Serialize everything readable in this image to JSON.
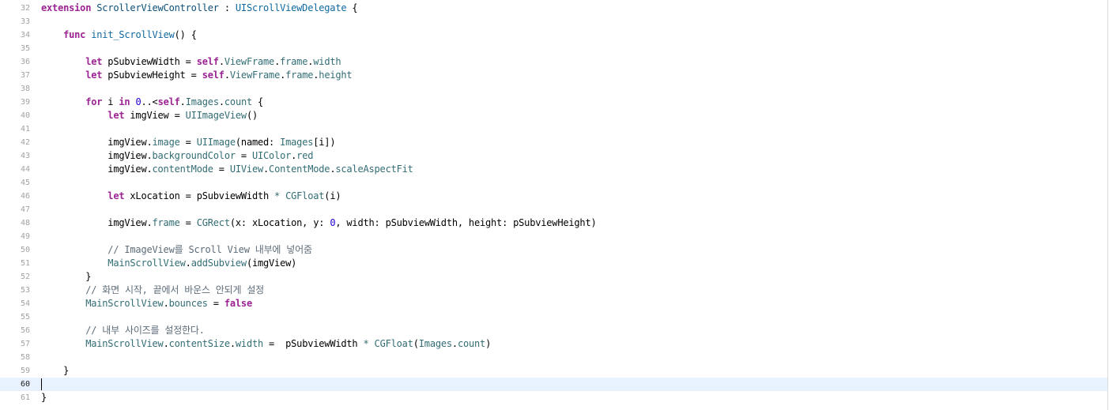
{
  "editor": {
    "current_line": 60,
    "lines": [
      {
        "n": "32",
        "tokens": [
          [
            "kw",
            "extension"
          ],
          [
            "plain",
            " "
          ],
          [
            "type",
            "ScrollerViewController"
          ],
          [
            "plain",
            " : "
          ],
          [
            "typedecl",
            "UIScrollViewDelegate"
          ],
          [
            "plain",
            " {"
          ]
        ]
      },
      {
        "n": "33",
        "tokens": []
      },
      {
        "n": "34",
        "tokens": [
          [
            "plain",
            "    "
          ],
          [
            "kw",
            "func"
          ],
          [
            "plain",
            " "
          ],
          [
            "typedecl",
            "init_ScrollView"
          ],
          [
            "plain",
            "() {"
          ]
        ]
      },
      {
        "n": "35",
        "tokens": []
      },
      {
        "n": "36",
        "tokens": [
          [
            "plain",
            "        "
          ],
          [
            "kw",
            "let"
          ],
          [
            "plain",
            " pSubviewWidth = "
          ],
          [
            "kw",
            "self"
          ],
          [
            "plain",
            "."
          ],
          [
            "prop",
            "ViewFrame"
          ],
          [
            "plain",
            "."
          ],
          [
            "prop",
            "frame"
          ],
          [
            "plain",
            "."
          ],
          [
            "prop",
            "width"
          ]
        ]
      },
      {
        "n": "37",
        "tokens": [
          [
            "plain",
            "        "
          ],
          [
            "kw",
            "let"
          ],
          [
            "plain",
            " pSubviewHeight = "
          ],
          [
            "kw",
            "self"
          ],
          [
            "plain",
            "."
          ],
          [
            "prop",
            "ViewFrame"
          ],
          [
            "plain",
            "."
          ],
          [
            "prop",
            "frame"
          ],
          [
            "plain",
            "."
          ],
          [
            "prop",
            "height"
          ]
        ]
      },
      {
        "n": "38",
        "tokens": []
      },
      {
        "n": "39",
        "tokens": [
          [
            "plain",
            "        "
          ],
          [
            "kw",
            "for"
          ],
          [
            "plain",
            " i "
          ],
          [
            "kw",
            "in"
          ],
          [
            "plain",
            " "
          ],
          [
            "num",
            "0"
          ],
          [
            "plain",
            "..<"
          ],
          [
            "kw",
            "self"
          ],
          [
            "plain",
            "."
          ],
          [
            "prop",
            "Images"
          ],
          [
            "plain",
            "."
          ],
          [
            "prop",
            "count"
          ],
          [
            "plain",
            " {"
          ]
        ]
      },
      {
        "n": "40",
        "tokens": [
          [
            "plain",
            "            "
          ],
          [
            "kw",
            "let"
          ],
          [
            "plain",
            " imgView = "
          ],
          [
            "prop",
            "UIImageView"
          ],
          [
            "plain",
            "()"
          ]
        ]
      },
      {
        "n": "41",
        "tokens": []
      },
      {
        "n": "42",
        "tokens": [
          [
            "plain",
            "            imgView."
          ],
          [
            "prop",
            "image"
          ],
          [
            "plain",
            " = "
          ],
          [
            "prop",
            "UIImage"
          ],
          [
            "plain",
            "(named: "
          ],
          [
            "prop",
            "Images"
          ],
          [
            "plain",
            "[i])"
          ]
        ]
      },
      {
        "n": "43",
        "tokens": [
          [
            "plain",
            "            imgView."
          ],
          [
            "prop",
            "backgroundColor"
          ],
          [
            "plain",
            " = "
          ],
          [
            "prop",
            "UIColor"
          ],
          [
            "plain",
            "."
          ],
          [
            "prop",
            "red"
          ]
        ]
      },
      {
        "n": "44",
        "tokens": [
          [
            "plain",
            "            imgView."
          ],
          [
            "prop",
            "contentMode"
          ],
          [
            "plain",
            " = "
          ],
          [
            "prop",
            "UIView"
          ],
          [
            "plain",
            "."
          ],
          [
            "prop",
            "ContentMode"
          ],
          [
            "plain",
            "."
          ],
          [
            "prop",
            "scaleAspectFit"
          ]
        ]
      },
      {
        "n": "45",
        "tokens": []
      },
      {
        "n": "46",
        "tokens": [
          [
            "plain",
            "            "
          ],
          [
            "kw",
            "let"
          ],
          [
            "plain",
            " xLocation = pSubviewWidth "
          ],
          [
            "prop",
            "*"
          ],
          [
            "plain",
            " "
          ],
          [
            "prop",
            "CGFloat"
          ],
          [
            "plain",
            "(i)"
          ]
        ]
      },
      {
        "n": "47",
        "tokens": []
      },
      {
        "n": "48",
        "tokens": [
          [
            "plain",
            "            imgView."
          ],
          [
            "prop",
            "frame"
          ],
          [
            "plain",
            " = "
          ],
          [
            "prop",
            "CGRect"
          ],
          [
            "plain",
            "(x: xLocation, y: "
          ],
          [
            "num",
            "0"
          ],
          [
            "plain",
            ", width: pSubviewWidth, height: pSubviewHeight)"
          ]
        ]
      },
      {
        "n": "49",
        "tokens": []
      },
      {
        "n": "50",
        "tokens": [
          [
            "plain",
            "            "
          ],
          [
            "comment",
            "// ImageView를 Scroll View 내부에 넣어줌"
          ]
        ]
      },
      {
        "n": "51",
        "tokens": [
          [
            "plain",
            "            "
          ],
          [
            "prop",
            "MainScrollView"
          ],
          [
            "plain",
            "."
          ],
          [
            "prop",
            "addSubview"
          ],
          [
            "plain",
            "(imgView)"
          ]
        ]
      },
      {
        "n": "52",
        "tokens": [
          [
            "plain",
            "        }"
          ]
        ]
      },
      {
        "n": "53",
        "tokens": [
          [
            "plain",
            "        "
          ],
          [
            "comment",
            "// 화면 시작, 끝에서 바운스 안되게 설정"
          ]
        ]
      },
      {
        "n": "54",
        "tokens": [
          [
            "plain",
            "        "
          ],
          [
            "prop",
            "MainScrollView"
          ],
          [
            "plain",
            "."
          ],
          [
            "prop",
            "bounces"
          ],
          [
            "plain",
            " = "
          ],
          [
            "kw",
            "false"
          ]
        ]
      },
      {
        "n": "55",
        "tokens": []
      },
      {
        "n": "56",
        "tokens": [
          [
            "plain",
            "        "
          ],
          [
            "comment",
            "// 내부 사이즈를 설정한다."
          ]
        ]
      },
      {
        "n": "57",
        "tokens": [
          [
            "plain",
            "        "
          ],
          [
            "prop",
            "MainScrollView"
          ],
          [
            "plain",
            "."
          ],
          [
            "prop",
            "contentSize"
          ],
          [
            "plain",
            "."
          ],
          [
            "prop",
            "width"
          ],
          [
            "plain",
            " =  pSubviewWidth "
          ],
          [
            "prop",
            "*"
          ],
          [
            "plain",
            " "
          ],
          [
            "prop",
            "CGFloat"
          ],
          [
            "plain",
            "("
          ],
          [
            "prop",
            "Images"
          ],
          [
            "plain",
            "."
          ],
          [
            "prop",
            "count"
          ],
          [
            "plain",
            ")"
          ]
        ]
      },
      {
        "n": "58",
        "tokens": []
      },
      {
        "n": "59",
        "tokens": [
          [
            "plain",
            "    }"
          ]
        ]
      },
      {
        "n": "60",
        "tokens": []
      },
      {
        "n": "61",
        "tokens": [
          [
            "plain",
            "}"
          ]
        ]
      }
    ]
  },
  "colors": {
    "keyword": "#9b2393",
    "type": "#0b4f79",
    "type_decl": "#0f68a0",
    "property": "#326d74",
    "number": "#1c00cf",
    "comment": "#5d6c79",
    "current_line_bg": "#e8f2fe",
    "line_number": "#a2a2a2"
  }
}
